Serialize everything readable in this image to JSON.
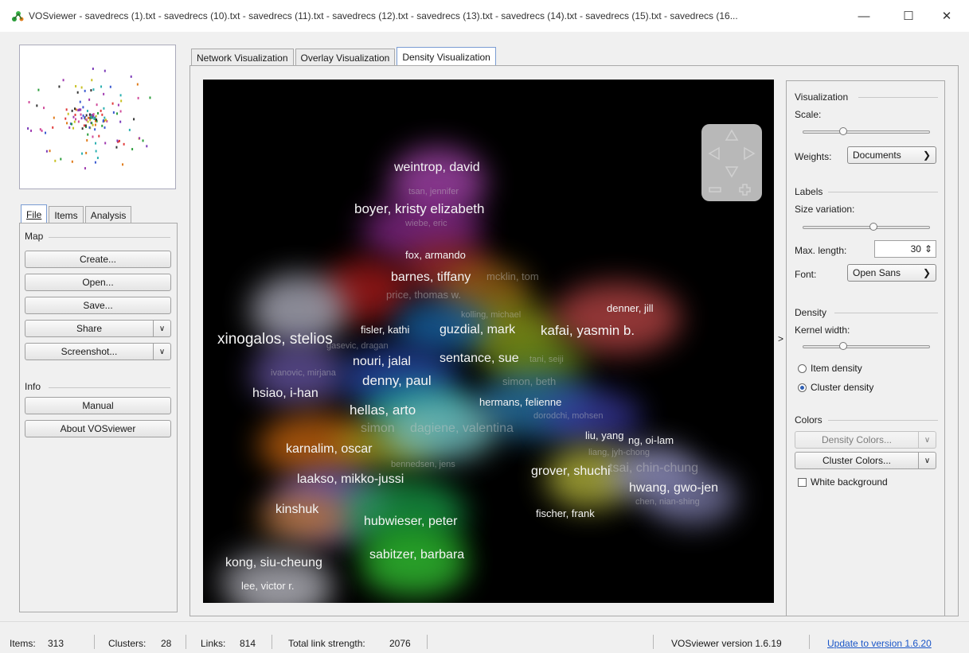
{
  "window": {
    "title": "VOSviewer - savedrecs (1).txt - savedrecs (10).txt - savedrecs (11).txt - savedrecs (12).txt - savedrecs (13).txt - savedrecs (14).txt - savedrecs (15).txt - savedrecs (16...",
    "minimize": "—",
    "maximize": "☐",
    "close": "✕"
  },
  "left_tabs": {
    "file": "File",
    "items": "Items",
    "analysis": "Analysis"
  },
  "map_group": {
    "label": "Map",
    "create": "Create...",
    "open": "Open...",
    "save": "Save...",
    "share": "Share",
    "screenshot": "Screenshot...",
    "dropdown_arrow": "∨"
  },
  "info_group": {
    "label": "Info",
    "manual": "Manual",
    "about": "About VOSviewer"
  },
  "main_tabs": {
    "network": "Network Visualization",
    "overlay": "Overlay Visualization",
    "density": "Density Visualization"
  },
  "expand_arrow": ">",
  "visualization": {
    "label": "Visualization",
    "scale_label": "Scale:",
    "scale_value": 0.3,
    "weights_label": "Weights:",
    "weights_value": "Documents"
  },
  "labels": {
    "label": "Labels",
    "size_variation_label": "Size variation:",
    "size_variation_value": 0.55,
    "max_length_label": "Max. length:",
    "max_length_value": "30",
    "font_label": "Font:",
    "font_value": "Open Sans"
  },
  "density": {
    "label": "Density",
    "kernel_width_label": "Kernel width:",
    "kernel_width_value": 0.3,
    "item_density": "Item density",
    "cluster_density": "Cluster density",
    "selected": "cluster_density"
  },
  "colors": {
    "label": "Colors",
    "density_colors": "Density Colors...",
    "cluster_colors": "Cluster Colors...",
    "white_background": "White background",
    "white_background_checked": false
  },
  "status": {
    "items_label": "Items:",
    "items_value": "313",
    "clusters_label": "Clusters:",
    "clusters_value": "28",
    "links_label": "Links:",
    "links_value": "814",
    "tls_label": "Total link strength:",
    "tls_value": "2076",
    "version": "VOSviewer version 1.6.19",
    "update_link": "Update to version 1.6.20"
  },
  "density_labels": [
    {
      "text": "weintrop, david",
      "bright": true,
      "size": "l"
    },
    {
      "text": "tsan, jennifer",
      "bright": false,
      "size": "s"
    },
    {
      "text": "boyer, kristy elizabeth",
      "bright": true,
      "size": "xl"
    },
    {
      "text": "wiebe, eric",
      "bright": false,
      "size": "s"
    },
    {
      "text": "fox, armando",
      "bright": true,
      "size": "m"
    },
    {
      "text": "barnes, tiffany",
      "bright": true,
      "size": "l"
    },
    {
      "text": "mcklin, tom",
      "bright": false,
      "size": "m"
    },
    {
      "text": "price, thomas w.",
      "bright": false,
      "size": "m"
    },
    {
      "text": "denner, jill",
      "bright": true,
      "size": "m"
    },
    {
      "text": "kolling, michael",
      "bright": false,
      "size": "s"
    },
    {
      "text": "xinogalos, stelios",
      "bright": true,
      "size": "xxl"
    },
    {
      "text": "fisler, kathi",
      "bright": true,
      "size": "m"
    },
    {
      "text": "guzdial, mark",
      "bright": true,
      "size": "l"
    },
    {
      "text": "kafai, yasmin b.",
      "bright": true,
      "size": "xl"
    },
    {
      "text": "gasevic, dragan",
      "bright": false,
      "size": "s"
    },
    {
      "text": "nouri, jalal",
      "bright": true,
      "size": "l"
    },
    {
      "text": "sentance, sue",
      "bright": true,
      "size": "l"
    },
    {
      "text": "tani, seiji",
      "bright": false,
      "size": "s"
    },
    {
      "text": "ivanovic, mirjana",
      "bright": false,
      "size": "s"
    },
    {
      "text": "denny, paul",
      "bright": true,
      "size": "xl"
    },
    {
      "text": "simon, beth",
      "bright": false,
      "size": "m"
    },
    {
      "text": "hsiao, i-han",
      "bright": true,
      "size": "l"
    },
    {
      "text": "hermans, felienne",
      "bright": true,
      "size": "m"
    },
    {
      "text": "hellas, arto",
      "bright": true,
      "size": "xl"
    },
    {
      "text": "dorodchi, mohsen",
      "bright": false,
      "size": "s"
    },
    {
      "text": "simon",
      "bright": false,
      "size": "l"
    },
    {
      "text": "dagiene, valentina",
      "bright": false,
      "size": "l"
    },
    {
      "text": "liu, yang",
      "bright": true,
      "size": "m"
    },
    {
      "text": "ng, oi-lam",
      "bright": true,
      "size": "m"
    },
    {
      "text": "karnalim, oscar",
      "bright": true,
      "size": "l"
    },
    {
      "text": "liang, jyh-chong",
      "bright": false,
      "size": "s"
    },
    {
      "text": "bennedsen, jens",
      "bright": false,
      "size": "s"
    },
    {
      "text": "grover, shuchi",
      "bright": true,
      "size": "l"
    },
    {
      "text": "tsai, chin-chung",
      "bright": false,
      "size": "l"
    },
    {
      "text": "laakso, mikko-jussi",
      "bright": true,
      "size": "l"
    },
    {
      "text": "hwang, gwo-jen",
      "bright": true,
      "size": "l"
    },
    {
      "text": "chen, nian-shing",
      "bright": false,
      "size": "s"
    },
    {
      "text": "kinshuk",
      "bright": true,
      "size": "l"
    },
    {
      "text": "fischer, frank",
      "bright": true,
      "size": "m"
    },
    {
      "text": "hubwieser, peter",
      "bright": true,
      "size": "l"
    },
    {
      "text": "sabitzer, barbara",
      "bright": true,
      "size": "l"
    },
    {
      "text": "kong, siu-cheung",
      "bright": true,
      "size": "l"
    },
    {
      "text": "lee, victor r.",
      "bright": true,
      "size": "m"
    }
  ]
}
